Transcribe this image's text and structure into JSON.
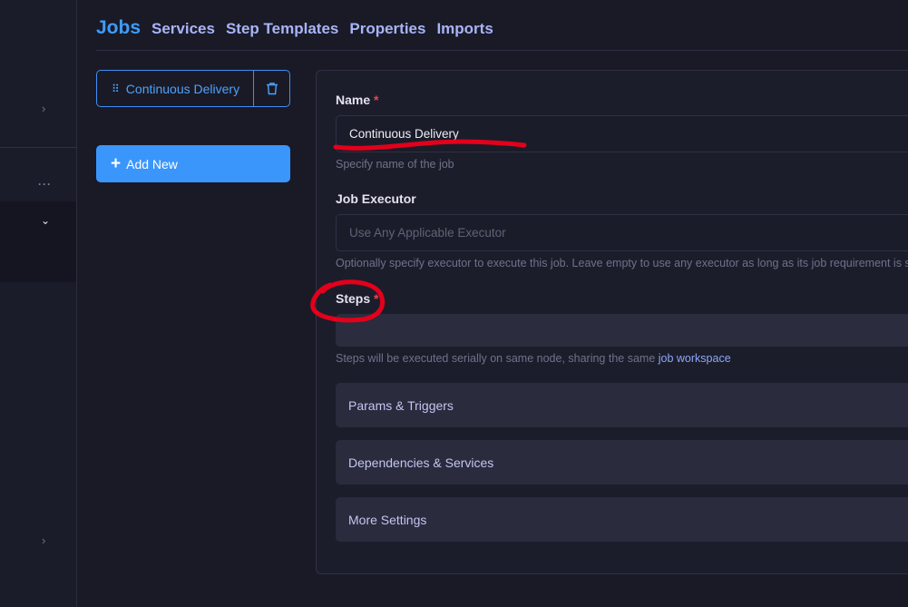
{
  "sidebar": {
    "icons": [
      "chevron-right-icon",
      "more-dots-icon",
      "chevron-down-icon",
      "chevron-right-icon"
    ]
  },
  "nav": {
    "tabs": [
      "Jobs",
      "Services",
      "Step Templates",
      "Properties",
      "Imports"
    ],
    "active": "Jobs"
  },
  "jobs": {
    "items": [
      {
        "name": "Continuous Delivery"
      }
    ],
    "add_label": "Add New"
  },
  "form": {
    "name": {
      "label": "Name",
      "required": "*",
      "value": "Continuous Delivery",
      "help": "Specify name of the job"
    },
    "executor": {
      "label": "Job Executor",
      "placeholder": "Use Any Applicable Executor",
      "help": "Optionally specify executor to execute this job. Leave empty to use any executor as long as its job requirement is s"
    },
    "steps": {
      "label": "Steps",
      "required": "*",
      "help": "Steps will be executed serially on same node, sharing the same ",
      "help_link": "job workspace"
    },
    "sections": [
      "Params & Triggers",
      "Dependencies & Services",
      "More Settings"
    ]
  },
  "colors": {
    "accent": "#3a96fb",
    "annotation": "#e3001b",
    "required": "#e5484d"
  }
}
